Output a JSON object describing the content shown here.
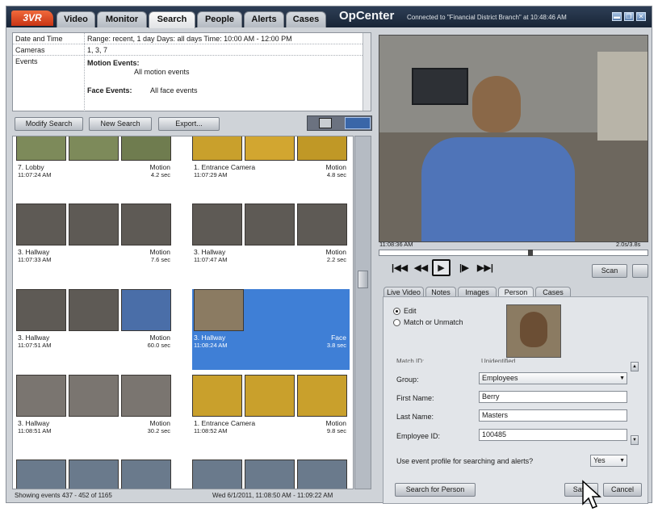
{
  "titlebar": {
    "logo": "3VR",
    "tabs": [
      "Video",
      "Monitor",
      "Search",
      "People",
      "Alerts",
      "Cases"
    ],
    "active_tab": "Search",
    "app_title": "OpCenter",
    "connection": "Connected to \"Financial District Branch\" at 10:48:46 AM"
  },
  "criteria": {
    "date_label": "Date and Time",
    "date_value": "Range: recent, 1 day  Days: all days  Time: 10:00 AM - 12:00 PM",
    "cameras_label": "Cameras",
    "cameras_value": "1, 3, 7",
    "events_label": "Events",
    "motion_title": "Motion Events:",
    "motion_value": "All motion events",
    "face_title": "Face Events:",
    "face_value": "All face events"
  },
  "toolbar": {
    "modify": "Modify Search",
    "new": "New Search",
    "export": "Export..."
  },
  "results": [
    {
      "loc": "7. Lobby",
      "type": "Motion",
      "time": "11:07:24 AM",
      "dur": "4.2 sec"
    },
    {
      "loc": "1. Entrance Camera",
      "type": "Motion",
      "time": "11:07:29 AM",
      "dur": "4.8 sec"
    },
    {
      "loc": "3. Hallway",
      "type": "Motion",
      "time": "11:07:33 AM",
      "dur": "7.6 sec"
    },
    {
      "loc": "3. Hallway",
      "type": "Motion",
      "time": "11:07:47 AM",
      "dur": "2.2 sec"
    },
    {
      "loc": "3. Hallway",
      "type": "Motion",
      "time": "11:07:51 AM",
      "dur": "60.0 sec"
    },
    {
      "loc": "3. Hallway",
      "type": "Face",
      "time": "11:08:24 AM",
      "dur": "3.8 sec"
    },
    {
      "loc": "3. Hallway",
      "type": "Motion",
      "time": "11:08:51 AM",
      "dur": "30.2 sec"
    },
    {
      "loc": "1. Entrance Camera",
      "type": "Motion",
      "time": "11:08:52 AM",
      "dur": "9.8 sec"
    }
  ],
  "status": {
    "left": "Showing events 437 - 452 of 1165",
    "right": "Wed 6/1/2011, 11:08:50 AM - 11:09:22 AM"
  },
  "player": {
    "time_left": "11:08:36 AM",
    "time_right": "2.0s/3.8s",
    "scan": "Scan",
    "controls": [
      "|◀◀",
      "◀◀",
      "▶",
      "|▶",
      "▶▶|"
    ]
  },
  "details": {
    "tabs": [
      "Live Video",
      "Notes",
      "Images",
      "Person",
      "Cases"
    ],
    "active_tab": "Person",
    "radio_edit": "Edit",
    "radio_match": "Match or Unmatch",
    "match_id_label": "Match ID:",
    "match_id_value": "Unidentified",
    "group_label": "Group:",
    "group_value": "Employees",
    "first_label": "First Name:",
    "first_value": "Berry",
    "last_label": "Last Name:",
    "last_value": "Masters",
    "emp_label": "Employee ID:",
    "emp_value": "100485",
    "profile_q": "Use event profile for searching and alerts?",
    "profile_value": "Yes",
    "search_btn": "Search for Person",
    "save_btn": "Save",
    "cancel_btn": "Cancel"
  },
  "colors": {
    "titlebar": "#1f2d41",
    "logo": "#e04a20",
    "selection": "#3f7fd6"
  }
}
